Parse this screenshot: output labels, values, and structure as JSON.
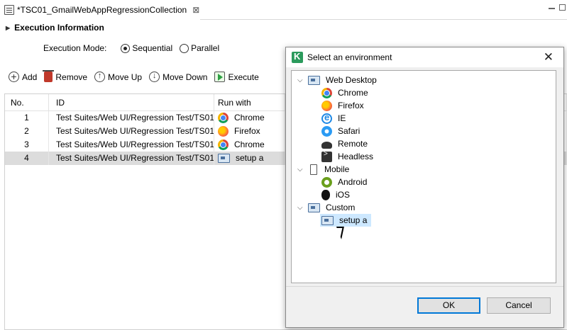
{
  "tab": {
    "title": "*TSC01_GmailWebAppRegressionCollection",
    "close": "⊠"
  },
  "section": {
    "title": "Execution Information"
  },
  "execution_mode": {
    "label": "Execution Mode:",
    "options": [
      "Sequential",
      "Parallel"
    ],
    "selected": "Sequential"
  },
  "toolbar": {
    "add": "Add",
    "remove": "Remove",
    "move_up": "Move Up",
    "move_down": "Move Down",
    "execute": "Execute"
  },
  "table": {
    "columns": [
      "No.",
      "ID",
      "Run with"
    ],
    "rows": [
      {
        "no": "1",
        "id": "Test Suites/Web UI/Regression Test/TS01_",
        "run_with": "Chrome",
        "icon": "chrome-icon"
      },
      {
        "no": "2",
        "id": "Test Suites/Web UI/Regression Test/TS01_",
        "run_with": "Firefox",
        "icon": "firefox-icon"
      },
      {
        "no": "3",
        "id": "Test Suites/Web UI/Regression Test/TS01_",
        "run_with": "Chrome",
        "icon": "chrome-icon"
      },
      {
        "no": "4",
        "id": "Test Suites/Web UI/Regression Test/TS01_",
        "run_with": "setup a",
        "icon": "custom-desktop-icon"
      }
    ],
    "selected_row": "4"
  },
  "dialog": {
    "title": "Select an environment",
    "groups": [
      {
        "label": "Web Desktop",
        "items": [
          "Chrome",
          "Firefox",
          "IE",
          "Safari",
          "Remote",
          "Headless"
        ]
      },
      {
        "label": "Mobile",
        "items": [
          "Android",
          "iOS"
        ]
      },
      {
        "label": "Custom",
        "items": [
          "setup a"
        ]
      }
    ],
    "selected_item": "setup a",
    "ok_label": "OK",
    "cancel_label": "Cancel"
  },
  "colors": {
    "selection_row": "#dcdcdc",
    "tree_selection": "#cde8ff",
    "ok_border": "#0078d7"
  }
}
